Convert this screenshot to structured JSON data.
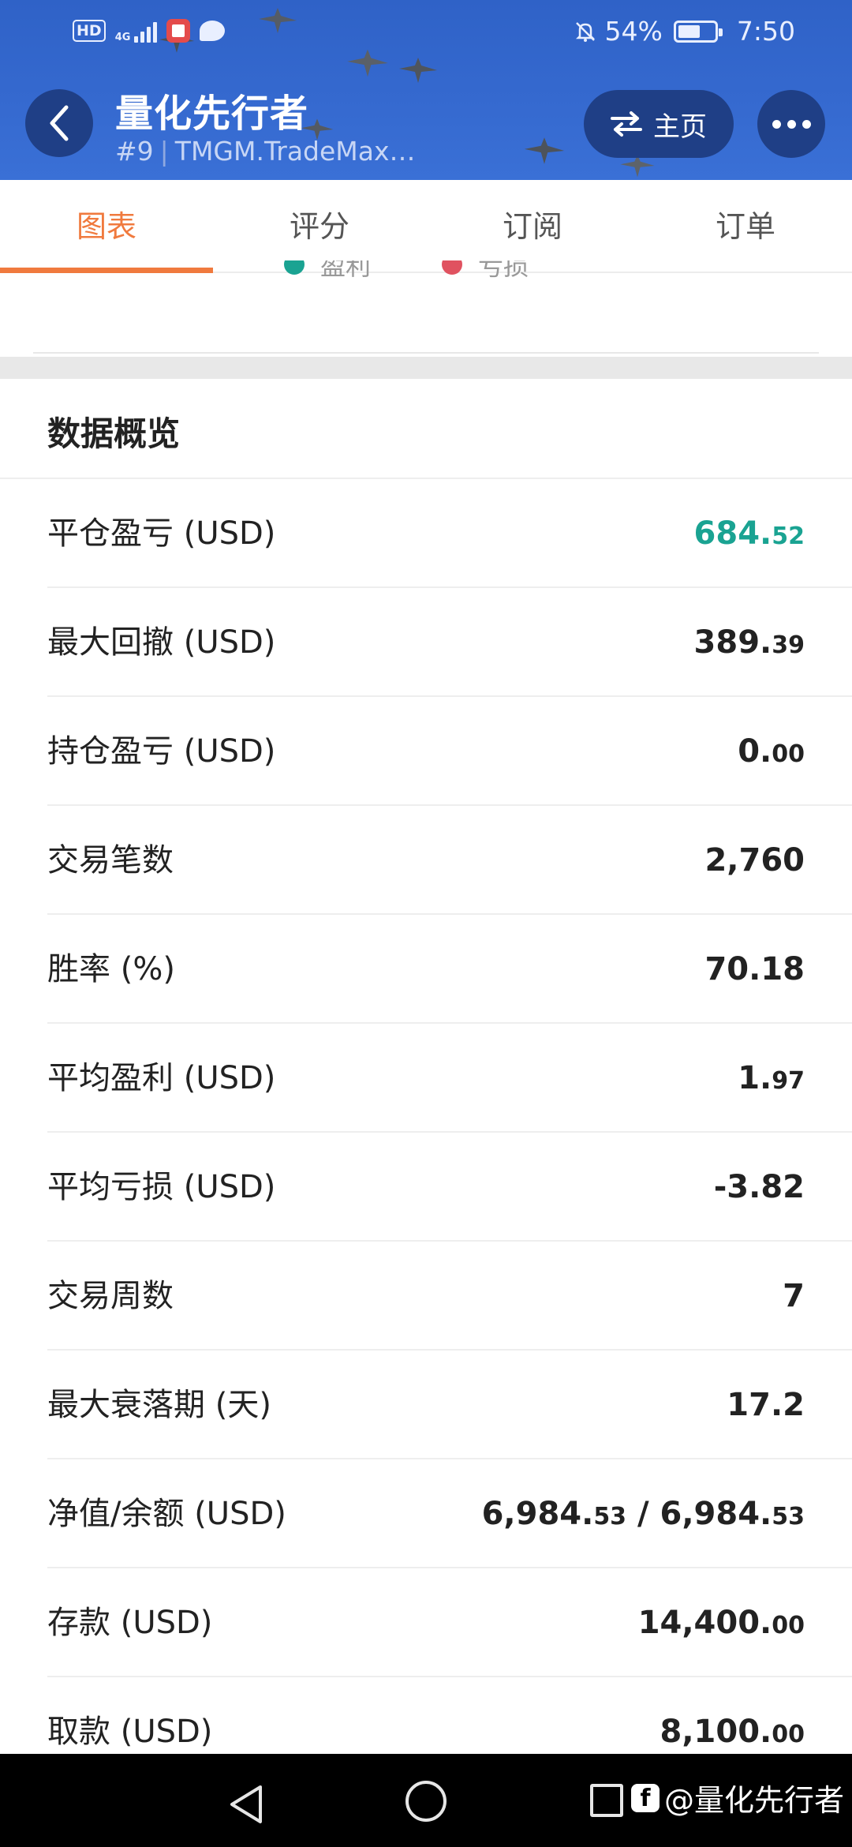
{
  "status_bar": {
    "hd": "HD",
    "network": "4G",
    "battery": "54%",
    "time": "7:50"
  },
  "header": {
    "title": "量化先行者",
    "rank": "#9",
    "broker": "TMGM.TradeMax…",
    "home_label": "主页",
    "colors": {
      "background": "#3569cf",
      "button": "#1f3f86"
    }
  },
  "tabs": [
    {
      "label": "图表",
      "active": true
    },
    {
      "label": "评分",
      "active": false
    },
    {
      "label": "订阅",
      "active": false
    },
    {
      "label": "订单",
      "active": false
    }
  ],
  "legend": [
    {
      "label": "盈利",
      "color": "#1aa392"
    },
    {
      "label": "亏损",
      "color": "#e05260"
    }
  ],
  "overview": {
    "title": "数据概览",
    "rows": [
      {
        "label": "平仓盈亏 (USD)",
        "int": "684.",
        "dec": "52",
        "color": "green"
      },
      {
        "label": "最大回撤 (USD)",
        "int": "389.",
        "dec": "39"
      },
      {
        "label": "持仓盈亏 (USD)",
        "int": "0.",
        "dec": "00"
      },
      {
        "label": "交易笔数",
        "int": "2,760",
        "dec": ""
      },
      {
        "label": "胜率 (%)",
        "int": "70.18",
        "dec": ""
      },
      {
        "label": "平均盈利 (USD)",
        "int": "1.",
        "dec": "97"
      },
      {
        "label": "平均亏损 (USD)",
        "int": "-3.82",
        "dec": ""
      },
      {
        "label": "交易周数",
        "int": "7",
        "dec": ""
      },
      {
        "label": "最大衰落期 (天)",
        "int": "17.2",
        "dec": ""
      },
      {
        "label": "净值/余额 (USD)",
        "int": "6,984.",
        "dec": "53",
        "int2": " / 6,984.",
        "dec2": "53"
      },
      {
        "label": "存款 (USD)",
        "int": "14,400.",
        "dec": "00"
      },
      {
        "label": "取款 (USD)",
        "int": "8,100.",
        "dec": "00"
      }
    ]
  },
  "navbar": {
    "watermark": "@量化先行者",
    "fb_glyph": "f"
  }
}
